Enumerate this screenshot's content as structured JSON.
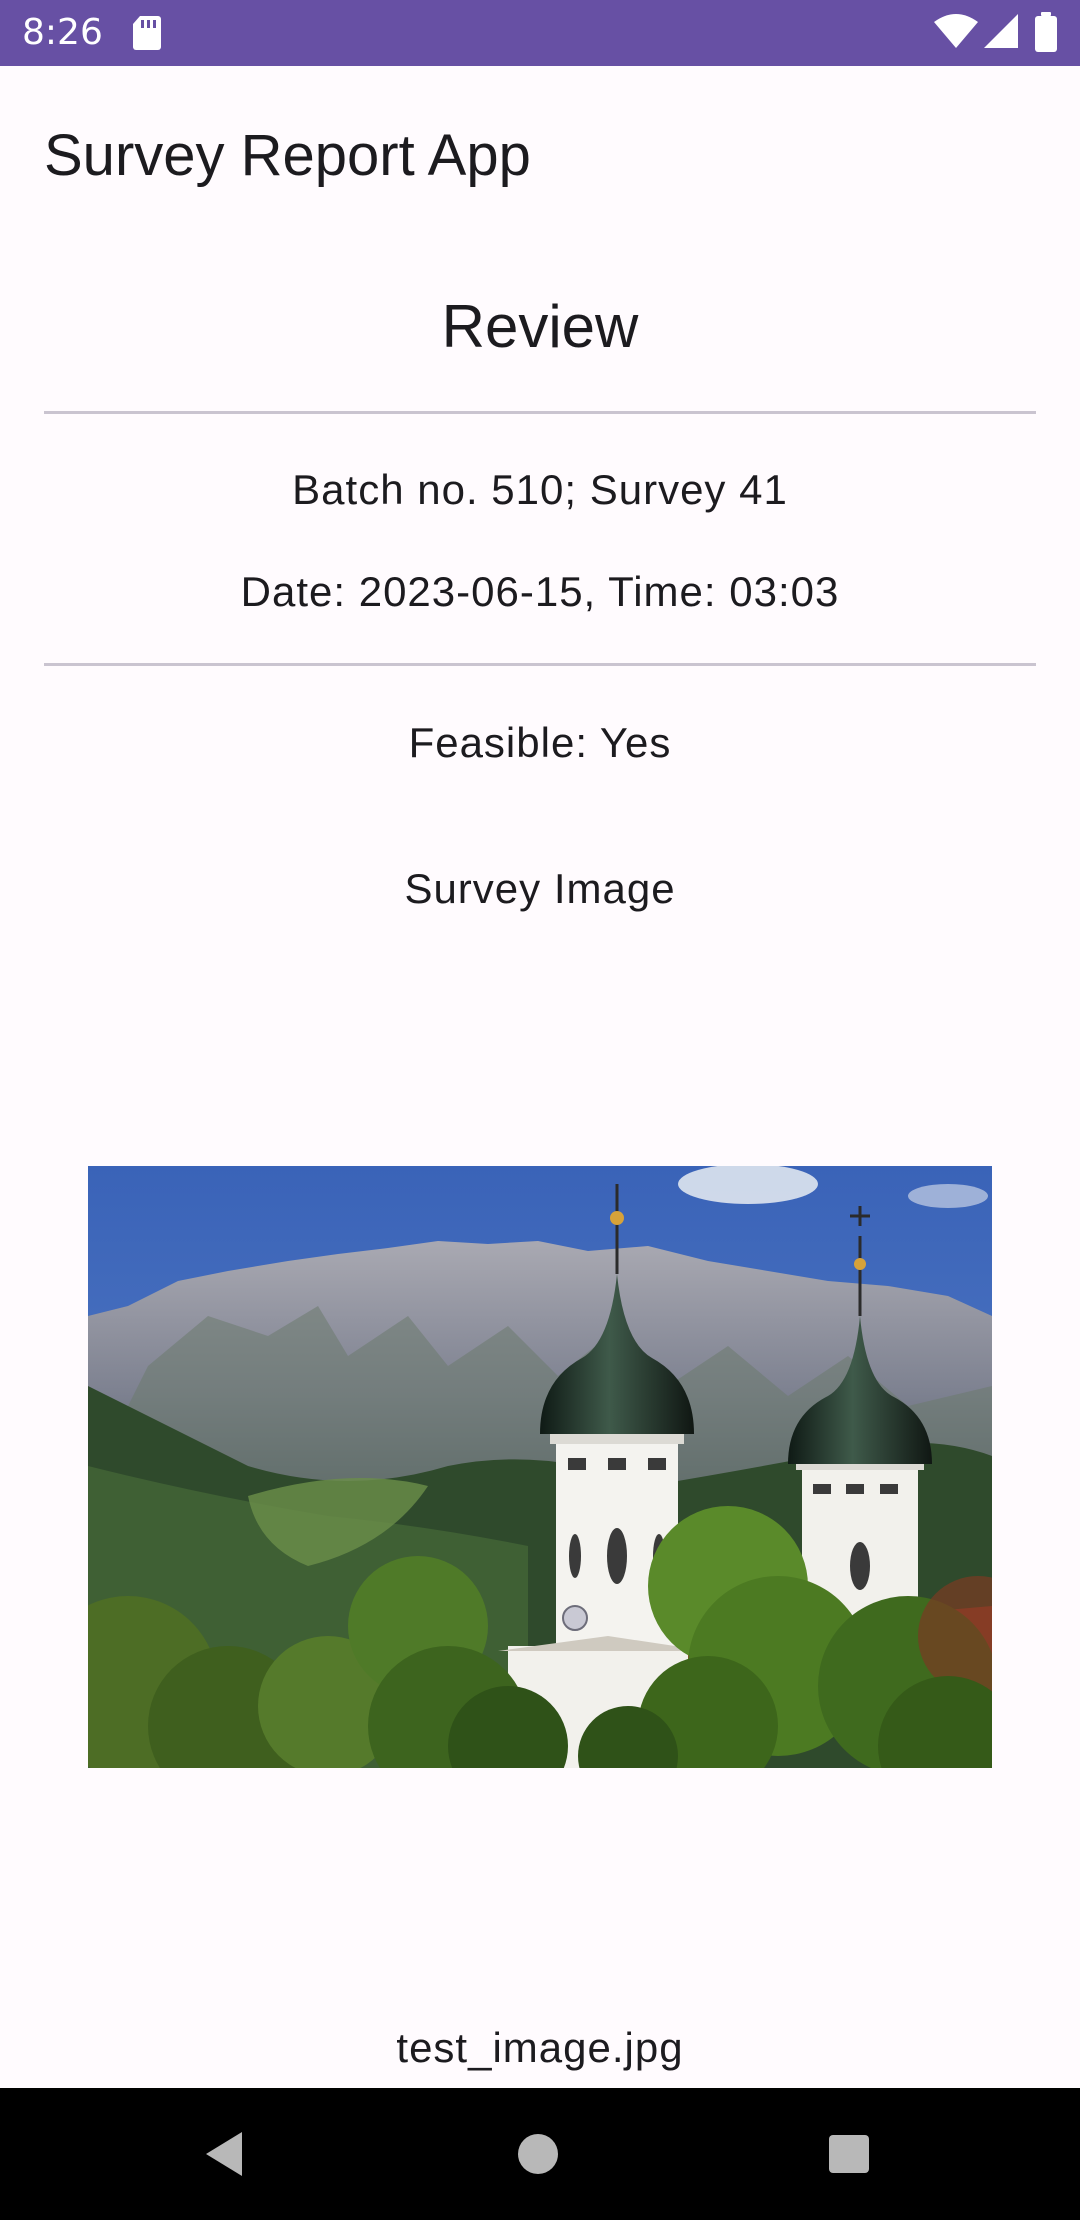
{
  "status_bar": {
    "time": "8:26",
    "icons": [
      "sd-card-icon",
      "wifi-icon",
      "cell-signal-icon",
      "battery-icon"
    ],
    "background": "#6750a4"
  },
  "app": {
    "title": "Survey Report App"
  },
  "review": {
    "heading": "Review",
    "batch_line": "Batch no. 510; Survey 41",
    "date_line": "Date: 2023-06-15, Time: 03:03",
    "feasible_line": "Feasible: Yes",
    "image_label": "Survey Image",
    "image_filename": "test_image.jpg"
  },
  "nav_bar": {
    "icons": [
      "back-icon",
      "home-icon",
      "recents-icon"
    ]
  }
}
